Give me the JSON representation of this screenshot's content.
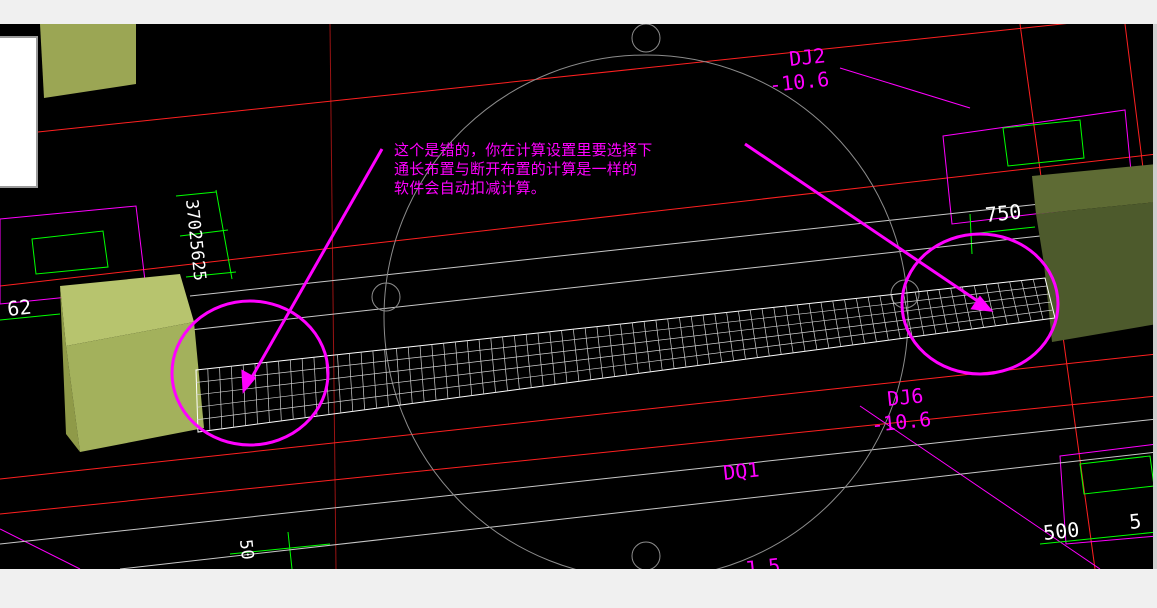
{
  "cad": {
    "labels": {
      "dj2": "DJ2",
      "dj2_elev": "-10.6",
      "dj6": "DJ6",
      "dj6_elev": "-10.6",
      "dq1": "DQ1",
      "dim_750": "750",
      "dim_62": "62",
      "dim_500": "500",
      "dim_5": "5",
      "dim_vertical": "37025625",
      "dim_bottom": "50",
      "partial_bottom": "J 5"
    },
    "annotation": {
      "line1": "这个是错的，你在计算设置里要选择下",
      "line2": "通长布置与断开布置的计算是一样的",
      "line3": "软件会自动扣减计算。"
    },
    "colors": {
      "background": "#000000",
      "axis": "#ff0000",
      "outline": "#ff00ff",
      "dimension": "#00ff00",
      "mesh": "#ffffff",
      "column": "#a4b25a",
      "highlight": "#ff00ff"
    }
  }
}
